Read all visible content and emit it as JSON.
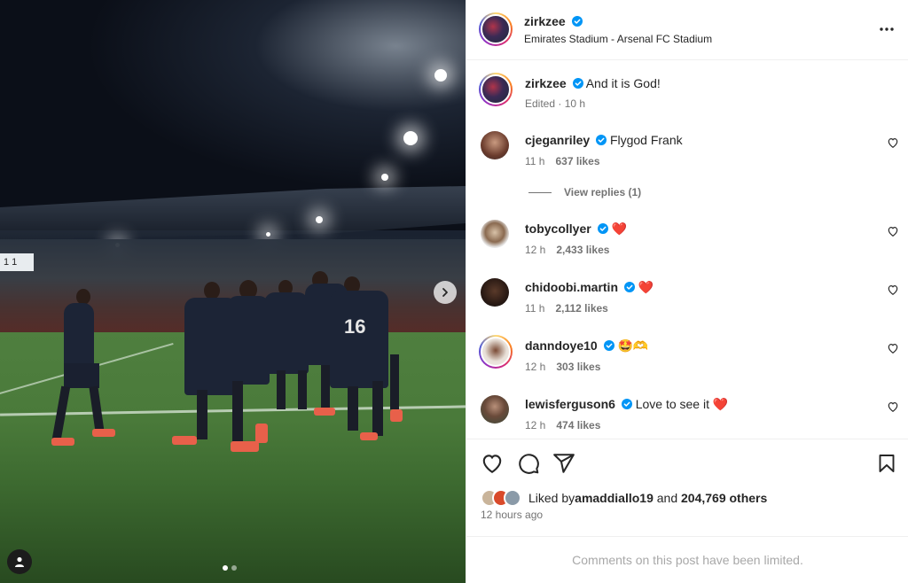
{
  "post": {
    "author": "zirkzee",
    "location": "Emirates Stadium - Arsenal FC Stadium",
    "caption": "And it is God!",
    "caption_meta": "Edited · 10 h",
    "scoreboard_text": "1 1"
  },
  "comments": [
    {
      "user": "cjeganriley",
      "text": "Flygod Frank",
      "time": "11 h",
      "likes": "637 likes"
    },
    {
      "user": "tobycollyer",
      "text": "❤️",
      "time": "12 h",
      "likes": "2,433 likes"
    },
    {
      "user": "chidoobi.martin",
      "text": "❤️",
      "time": "11 h",
      "likes": "2,112 likes"
    },
    {
      "user": "danndoye10",
      "text": "🤩🫶",
      "time": "12 h",
      "likes": "303 likes"
    },
    {
      "user": "lewisferguson6",
      "text": "Love to see it ❤️",
      "time": "12 h",
      "likes": "474 likes"
    }
  ],
  "view_replies": "View replies (1)",
  "likes_summary": {
    "prefix": "Liked by ",
    "user": "amaddiallo19",
    "middle": " and ",
    "count": "204,769 others"
  },
  "posted_ago": "12 hours ago",
  "comments_limited": "Comments on this post have been limited.",
  "icons": {
    "verified": "verified-badge-icon",
    "more": "more-options-icon",
    "like": "heart-icon",
    "comment": "comment-icon",
    "share": "share-icon",
    "save": "bookmark-icon"
  },
  "colors": {
    "verified": "#0095f6",
    "muted": "#737373",
    "text": "#262626"
  }
}
